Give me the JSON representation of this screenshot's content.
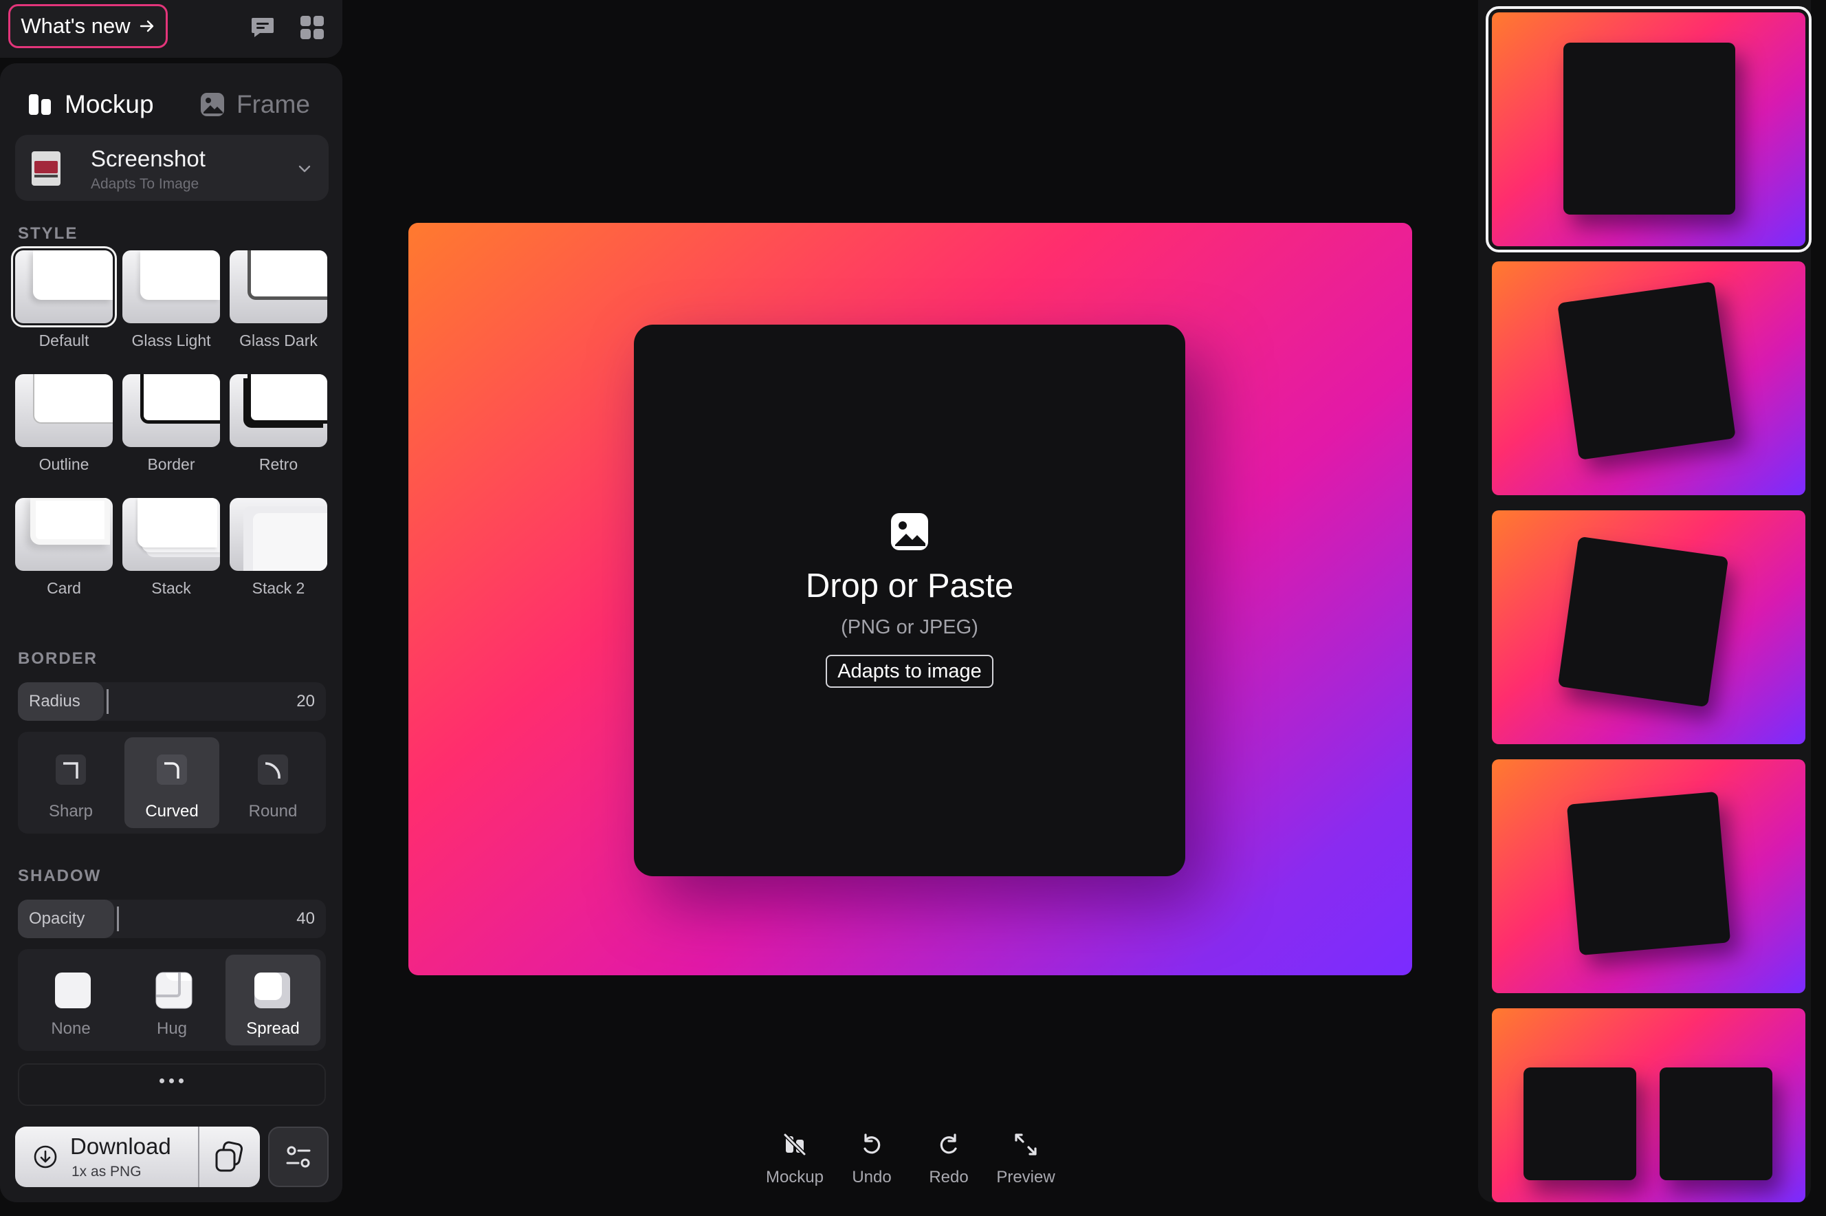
{
  "header": {
    "whats_new_label": "What's new"
  },
  "tabs": [
    {
      "label": "Mockup",
      "active": true
    },
    {
      "label": "Frame",
      "active": false
    }
  ],
  "device": {
    "title": "Screenshot",
    "subtitle": "Adapts To Image"
  },
  "style": {
    "section_label": "STYLE",
    "selected": "Default",
    "options": [
      "Default",
      "Glass Light",
      "Glass Dark",
      "Outline",
      "Border",
      "Retro",
      "Card",
      "Stack",
      "Stack 2"
    ]
  },
  "border": {
    "section_label": "BORDER",
    "radius_label": "Radius",
    "radius_value": "20",
    "radius_fraction": 0.5,
    "corner_options": [
      "Sharp",
      "Curved",
      "Round"
    ],
    "corner_selected": "Curved"
  },
  "shadow": {
    "section_label": "SHADOW",
    "opacity_label": "Opacity",
    "opacity_value": "40",
    "opacity_fraction": 0.4,
    "options": [
      "None",
      "Hug",
      "Spread"
    ],
    "selected": "Spread"
  },
  "download": {
    "title": "Download",
    "subtitle": "1x as PNG"
  },
  "canvas": {
    "drop_title": "Drop or Paste",
    "drop_subtitle": "(PNG or JPEG)",
    "adapts_button": "Adapts to image",
    "colors": {
      "start": "#ff7a2f",
      "mid": "#ff2d6e",
      "end": "#7a2cff"
    }
  },
  "toolbar": [
    {
      "label": "Mockup",
      "icon": "mockup-off-icon"
    },
    {
      "label": "Undo",
      "icon": "undo-icon"
    },
    {
      "label": "Redo",
      "icon": "redo-icon"
    },
    {
      "label": "Preview",
      "icon": "expand-icon"
    }
  ]
}
